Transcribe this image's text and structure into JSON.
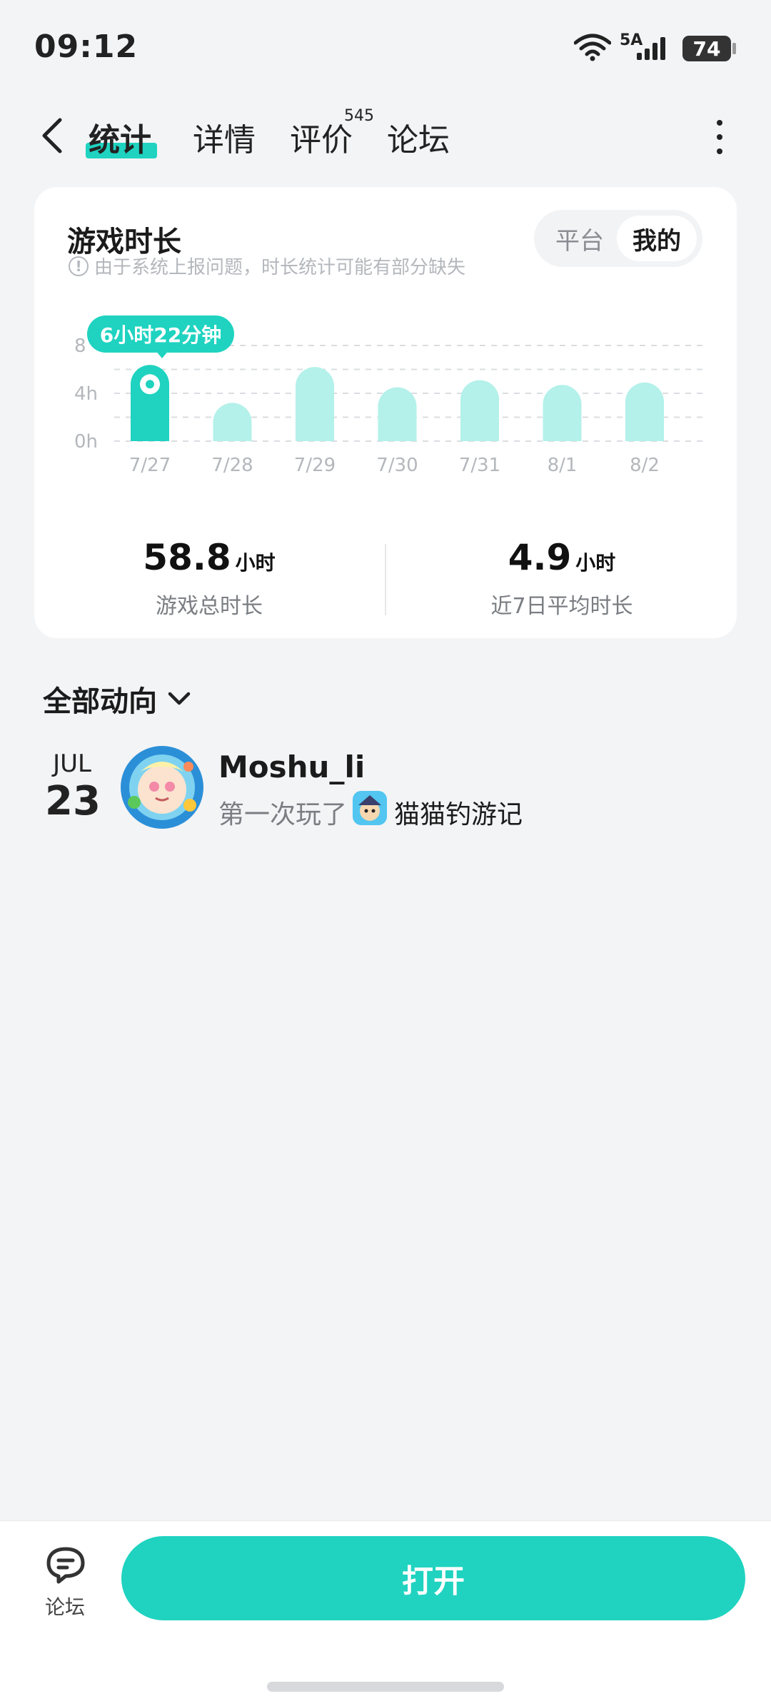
{
  "status_bar": {
    "time": "09:12",
    "network": "5A",
    "battery": "74"
  },
  "nav": {
    "tabs": [
      {
        "label": "统计",
        "active": true
      },
      {
        "label": "详情",
        "active": false
      },
      {
        "label": "评价",
        "active": false,
        "badge": "545"
      },
      {
        "label": "论坛",
        "active": false
      }
    ]
  },
  "stats_card": {
    "title": "游戏时长",
    "note": "由于系统上报问题，时长统计可能有部分缺失",
    "toggle": {
      "options": [
        "平台",
        "我的"
      ],
      "selected": "我的"
    },
    "tooltip": "6小时22分钟",
    "summary": [
      {
        "value": "58.8",
        "unit": "小时",
        "label": "游戏总时长"
      },
      {
        "value": "4.9",
        "unit": "小时",
        "label": "近7日平均时长"
      }
    ]
  },
  "chart_data": {
    "type": "bar",
    "categories": [
      "7/27",
      "7/28",
      "7/29",
      "7/30",
      "7/31",
      "8/1",
      "8/2"
    ],
    "values": [
      6.37,
      3.2,
      6.2,
      4.5,
      5.1,
      4.7,
      4.9
    ],
    "y_tick_labels": [
      "8",
      "4h",
      "0h"
    ],
    "ylim": [
      0,
      8
    ],
    "highlighted_index": 0,
    "colors": {
      "highlight": "#1fd3c0",
      "normal": "#b3f1ea"
    },
    "grid": true
  },
  "activity": {
    "title": "全部动向",
    "items": [
      {
        "month": "JUL",
        "day": "23",
        "user": "Moshu_li",
        "action": "第一次玩了",
        "game": "猫猫钓游记"
      }
    ]
  },
  "bottom": {
    "forum_label": "论坛",
    "open_label": "打开"
  },
  "colors": {
    "accent": "#1fd3c0",
    "background": "#f3f4f6"
  }
}
